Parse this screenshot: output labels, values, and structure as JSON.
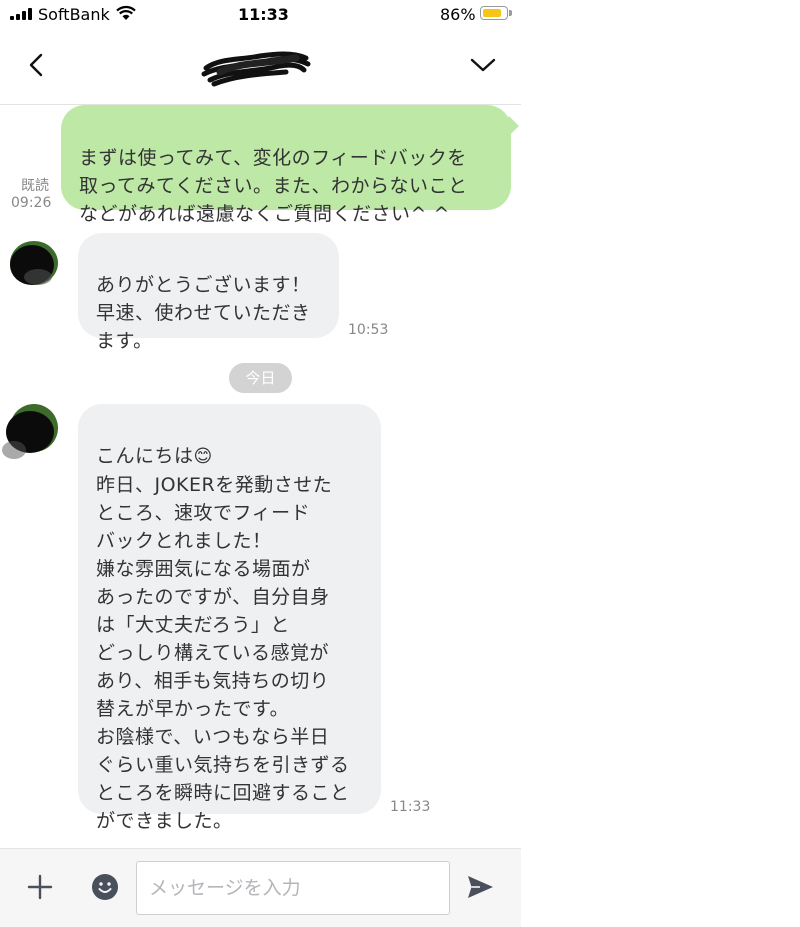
{
  "status_bar": {
    "carrier": "SoftBank",
    "time": "11:33",
    "battery_percent": "86%",
    "battery_level": 0.86,
    "battery_color": "#f5c518",
    "icons": [
      "signal-icon",
      "wifi-icon",
      "battery-icon"
    ]
  },
  "header": {
    "back_icon": "chevron-left-icon",
    "menu_icon": "chevron-down-icon",
    "contact_name_redacted": true
  },
  "messages": [
    {
      "direction": "outgoing",
      "text": "まずは使ってみて、変化のフィードバックを\n取ってみてください。また、わからないこと\nなどがあれば遠慮なくご質問ください^ ^",
      "read_label": "既読",
      "time": "09:26"
    },
    {
      "direction": "incoming",
      "text": "ありがとうございます！\n早速、使わせていただき\nます。",
      "time": "10:53"
    },
    {
      "direction": "incoming",
      "text_before_emoji": "こんにちは",
      "emoji": "😊",
      "text": "昨日、JOKERを発動させた\nところ、速攻でフィード\nバックとれました！\n嫌な雰囲気になる場面が\nあったのですが、自分自身\nは「大丈夫だろう」と\nどっしり構えている感覚が\nあり、相手も気持ちの切り\n替えが早かったです。\nお陰様で、いつもなら半日\nぐらい重い気持ちを引きずる\nところを瞬時に回避すること\nができました。",
      "time": "11:33"
    }
  ],
  "date_separator": "今日",
  "composer": {
    "placeholder": "メッセージを入力",
    "value": "",
    "icons": [
      "plus-icon",
      "smile-icon",
      "send-icon"
    ]
  },
  "colors": {
    "outgoing_bubble": "#bde8a6",
    "incoming_bubble": "#eff0f2",
    "date_pill": "#d3d3d3",
    "composer_bg": "#f6f6f7"
  }
}
